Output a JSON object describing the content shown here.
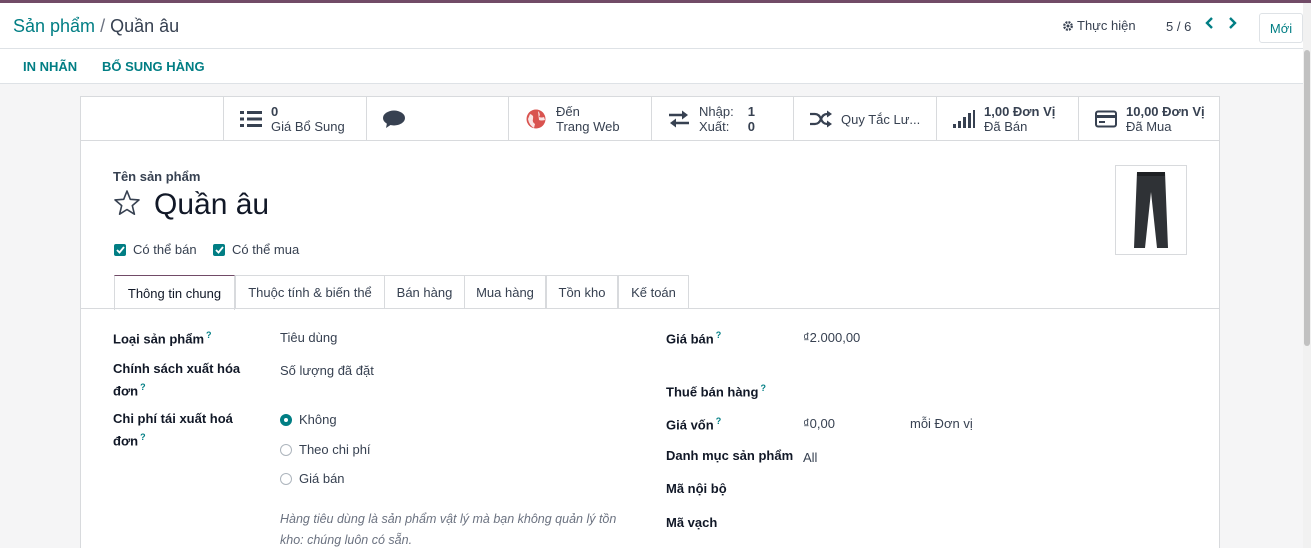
{
  "breadcrumb": {
    "parent": "Sản phẩm",
    "separator": "/",
    "current": "Quần âu"
  },
  "control": {
    "action_label": "Thực hiện",
    "pager": "5 / 6",
    "new_label": "Mới"
  },
  "statusbar": {
    "print_label": "IN NHÃN",
    "replenish_label": "BỔ SUNG HÀNG"
  },
  "smart_buttons": {
    "extra_prices": {
      "value": "0",
      "label": "Giá Bổ Sung"
    },
    "website": {
      "line1": "Đến",
      "line2": "Trang Web"
    },
    "in_out": {
      "in_label": "Nhập:",
      "in_value": "1",
      "out_label": "Xuất:",
      "out_value": "0"
    },
    "rules": {
      "label": "Quy Tắc Lư..."
    },
    "sold": {
      "value": "1,00 Đơn Vị",
      "label": "Đã Bán"
    },
    "purchased": {
      "value": "10,00 Đơn Vị",
      "label": "Đã Mua"
    }
  },
  "product": {
    "name_label": "Tên sản phẩm",
    "name": "Quần âu",
    "can_sell_label": "Có thể bán",
    "can_buy_label": "Có thể mua"
  },
  "tabs": [
    {
      "label": "Thông tin chung"
    },
    {
      "label": "Thuộc tính & biến thể"
    },
    {
      "label": "Bán hàng"
    },
    {
      "label": "Mua hàng"
    },
    {
      "label": "Tồn kho"
    },
    {
      "label": "Kế toán"
    }
  ],
  "general": {
    "product_type_label": "Loại sản phẩm",
    "product_type_value": "Tiêu dùng",
    "invoice_policy_label1": "Chính sách xuất hóa",
    "invoice_policy_label2": "đơn",
    "invoice_policy_value": "Số lượng đã đặt",
    "reinvoice_label1": "Chi phí tái xuất hoá",
    "reinvoice_label2": "đơn",
    "reinvoice_options": [
      "Không",
      "Theo chi phí",
      "Giá bán"
    ],
    "hint": "Hàng tiêu dùng là sản phẩm vật lý mà bạn không quản lý tồn kho: chúng luôn có sẵn.",
    "sale_price_label": "Giá bán",
    "sale_price_value": "₫2.000,00",
    "sale_tax_label": "Thuế bán hàng",
    "cost_label": "Giá vốn",
    "cost_value": "₫0,00",
    "cost_unit": "mỗi Đơn vị",
    "category_label": "Danh mục sản phẩm",
    "category_value": "All",
    "internal_ref_label": "Mã nội bộ",
    "barcode_label": "Mã vạch",
    "help_mark": "?"
  },
  "colors": {
    "brand": "#714b67",
    "accent": "#017e84"
  }
}
